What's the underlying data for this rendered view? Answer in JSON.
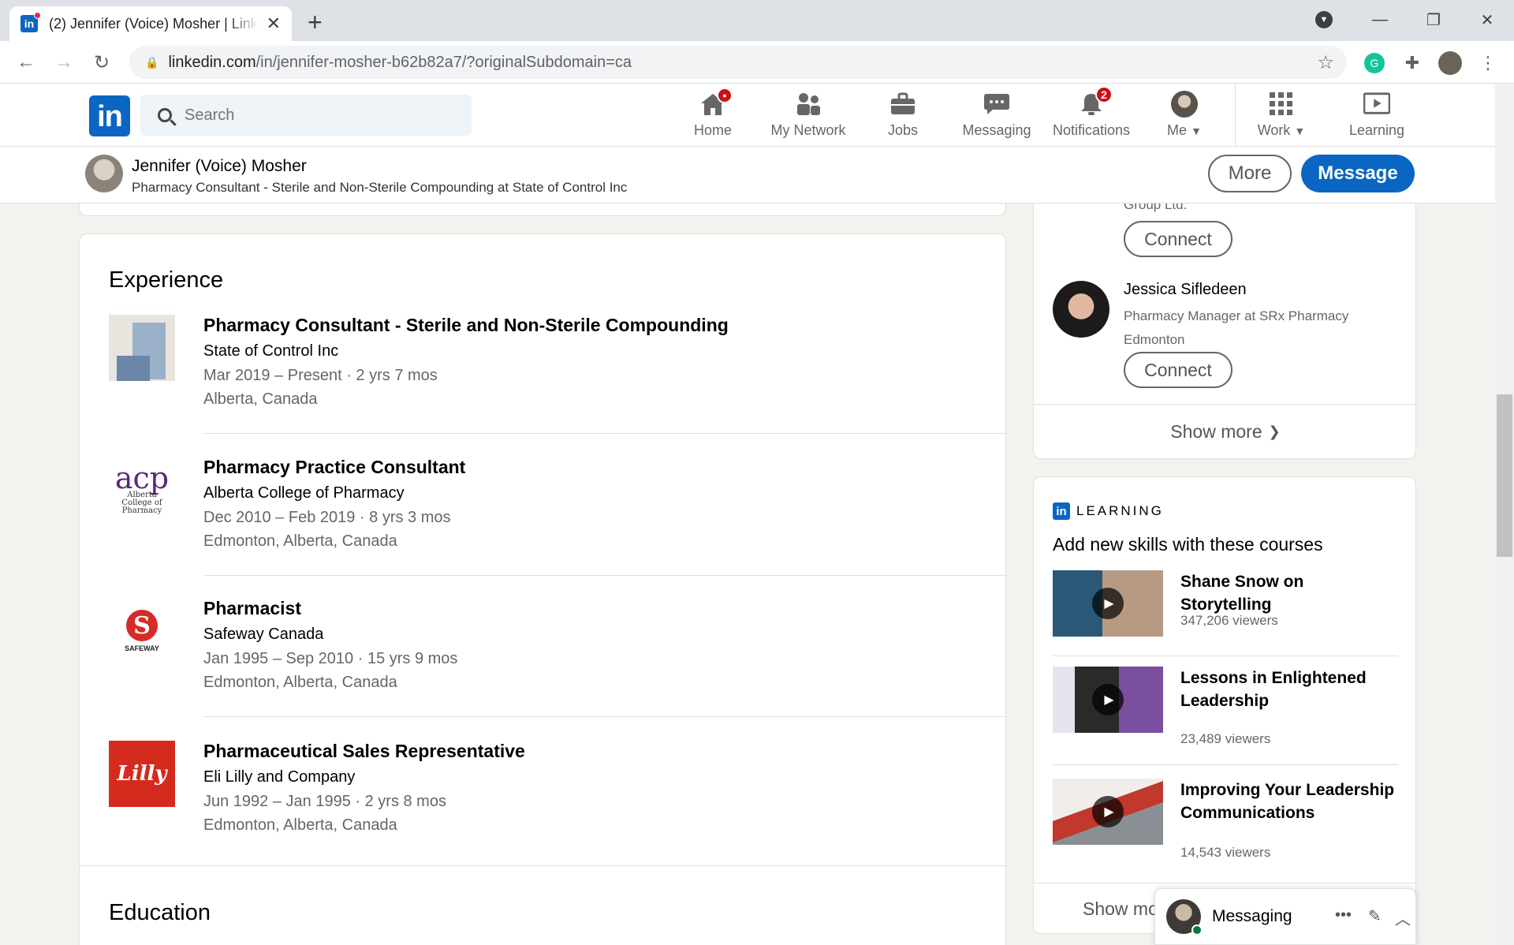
{
  "browser": {
    "tab_title": "(2) Jennifer (Voice) Mosher | LinkedIn",
    "url_host": "linkedin.com",
    "url_path": "/in/jennifer-mosher-b62b82a7/?originalSubdomain=ca"
  },
  "linkedin_nav": {
    "search_placeholder": "Search",
    "items": [
      {
        "label": "Home",
        "icon": "home-icon",
        "badge": ""
      },
      {
        "label": "My Network",
        "icon": "network-icon",
        "badge": ""
      },
      {
        "label": "Jobs",
        "icon": "briefcase-icon",
        "badge": ""
      },
      {
        "label": "Messaging",
        "icon": "chat-icon",
        "badge": ""
      },
      {
        "label": "Notifications",
        "icon": "bell-icon",
        "badge": "2"
      },
      {
        "label": "Me",
        "icon": "avatar-icon",
        "badge": ""
      },
      {
        "label": "Work",
        "icon": "grid-icon",
        "badge": ""
      },
      {
        "label": "Learning",
        "icon": "learning-icon",
        "badge": ""
      }
    ]
  },
  "profile_bar": {
    "name": "Jennifer (Voice) Mosher",
    "headline": "Pharmacy Consultant - Sterile and Non-Sterile Compounding at State of Control Inc",
    "more_label": "More",
    "message_label": "Message"
  },
  "experience": {
    "heading": "Experience",
    "jobs": [
      {
        "title": "Pharmacy Consultant - Sterile and Non-Sterile Compounding",
        "company": "State of Control Inc",
        "dates": "Mar 2019 – Present · 2 yrs 7 mos",
        "location": "Alberta, Canada"
      },
      {
        "title": "Pharmacy Practice Consultant",
        "company": "Alberta College of Pharmacy",
        "dates": "Dec 2010 – Feb 2019 · 8 yrs 3 mos",
        "location": "Edmonton, Alberta, Canada"
      },
      {
        "title": "Pharmacist",
        "company": "Safeway Canada",
        "dates": "Jan 1995 – Sep 2010 · 15 yrs 9 mos",
        "location": "Edmonton, Alberta, Canada"
      },
      {
        "title": "Pharmaceutical Sales Representative",
        "company": "Eli Lilly and Company",
        "dates": "Jun 1992 – Jan 1995 · 2 yrs 8 mos",
        "location": "Edmonton, Alberta, Canada"
      }
    ],
    "logo_text": {
      "acp_mark": "acp",
      "acp_name": "Alberta College of Pharmacy",
      "safeway": "SAFEWAY",
      "lilly": "Lilly"
    }
  },
  "education": {
    "heading": "Education"
  },
  "people_also_viewed": {
    "partial_text": "Group Ltd.",
    "connect_label": "Connect",
    "person": {
      "name": "Jessica Sifledeen",
      "headline": "Pharmacy Manager at SRx Pharmacy Edmonton"
    },
    "show_more": "Show more"
  },
  "learning": {
    "label": "LEARNING",
    "subtitle": "Add new skills with these courses",
    "courses": [
      {
        "title": "Shane Snow on Storytelling",
        "viewers": "347,206 viewers"
      },
      {
        "title": "Lessons in Enlightened Leadership",
        "viewers": "23,489 viewers"
      },
      {
        "title": "Improving Your Leadership Communications",
        "viewers": "14,543 viewers"
      }
    ],
    "show_more": "Show more"
  },
  "messaging_overlay": {
    "label": "Messaging"
  }
}
